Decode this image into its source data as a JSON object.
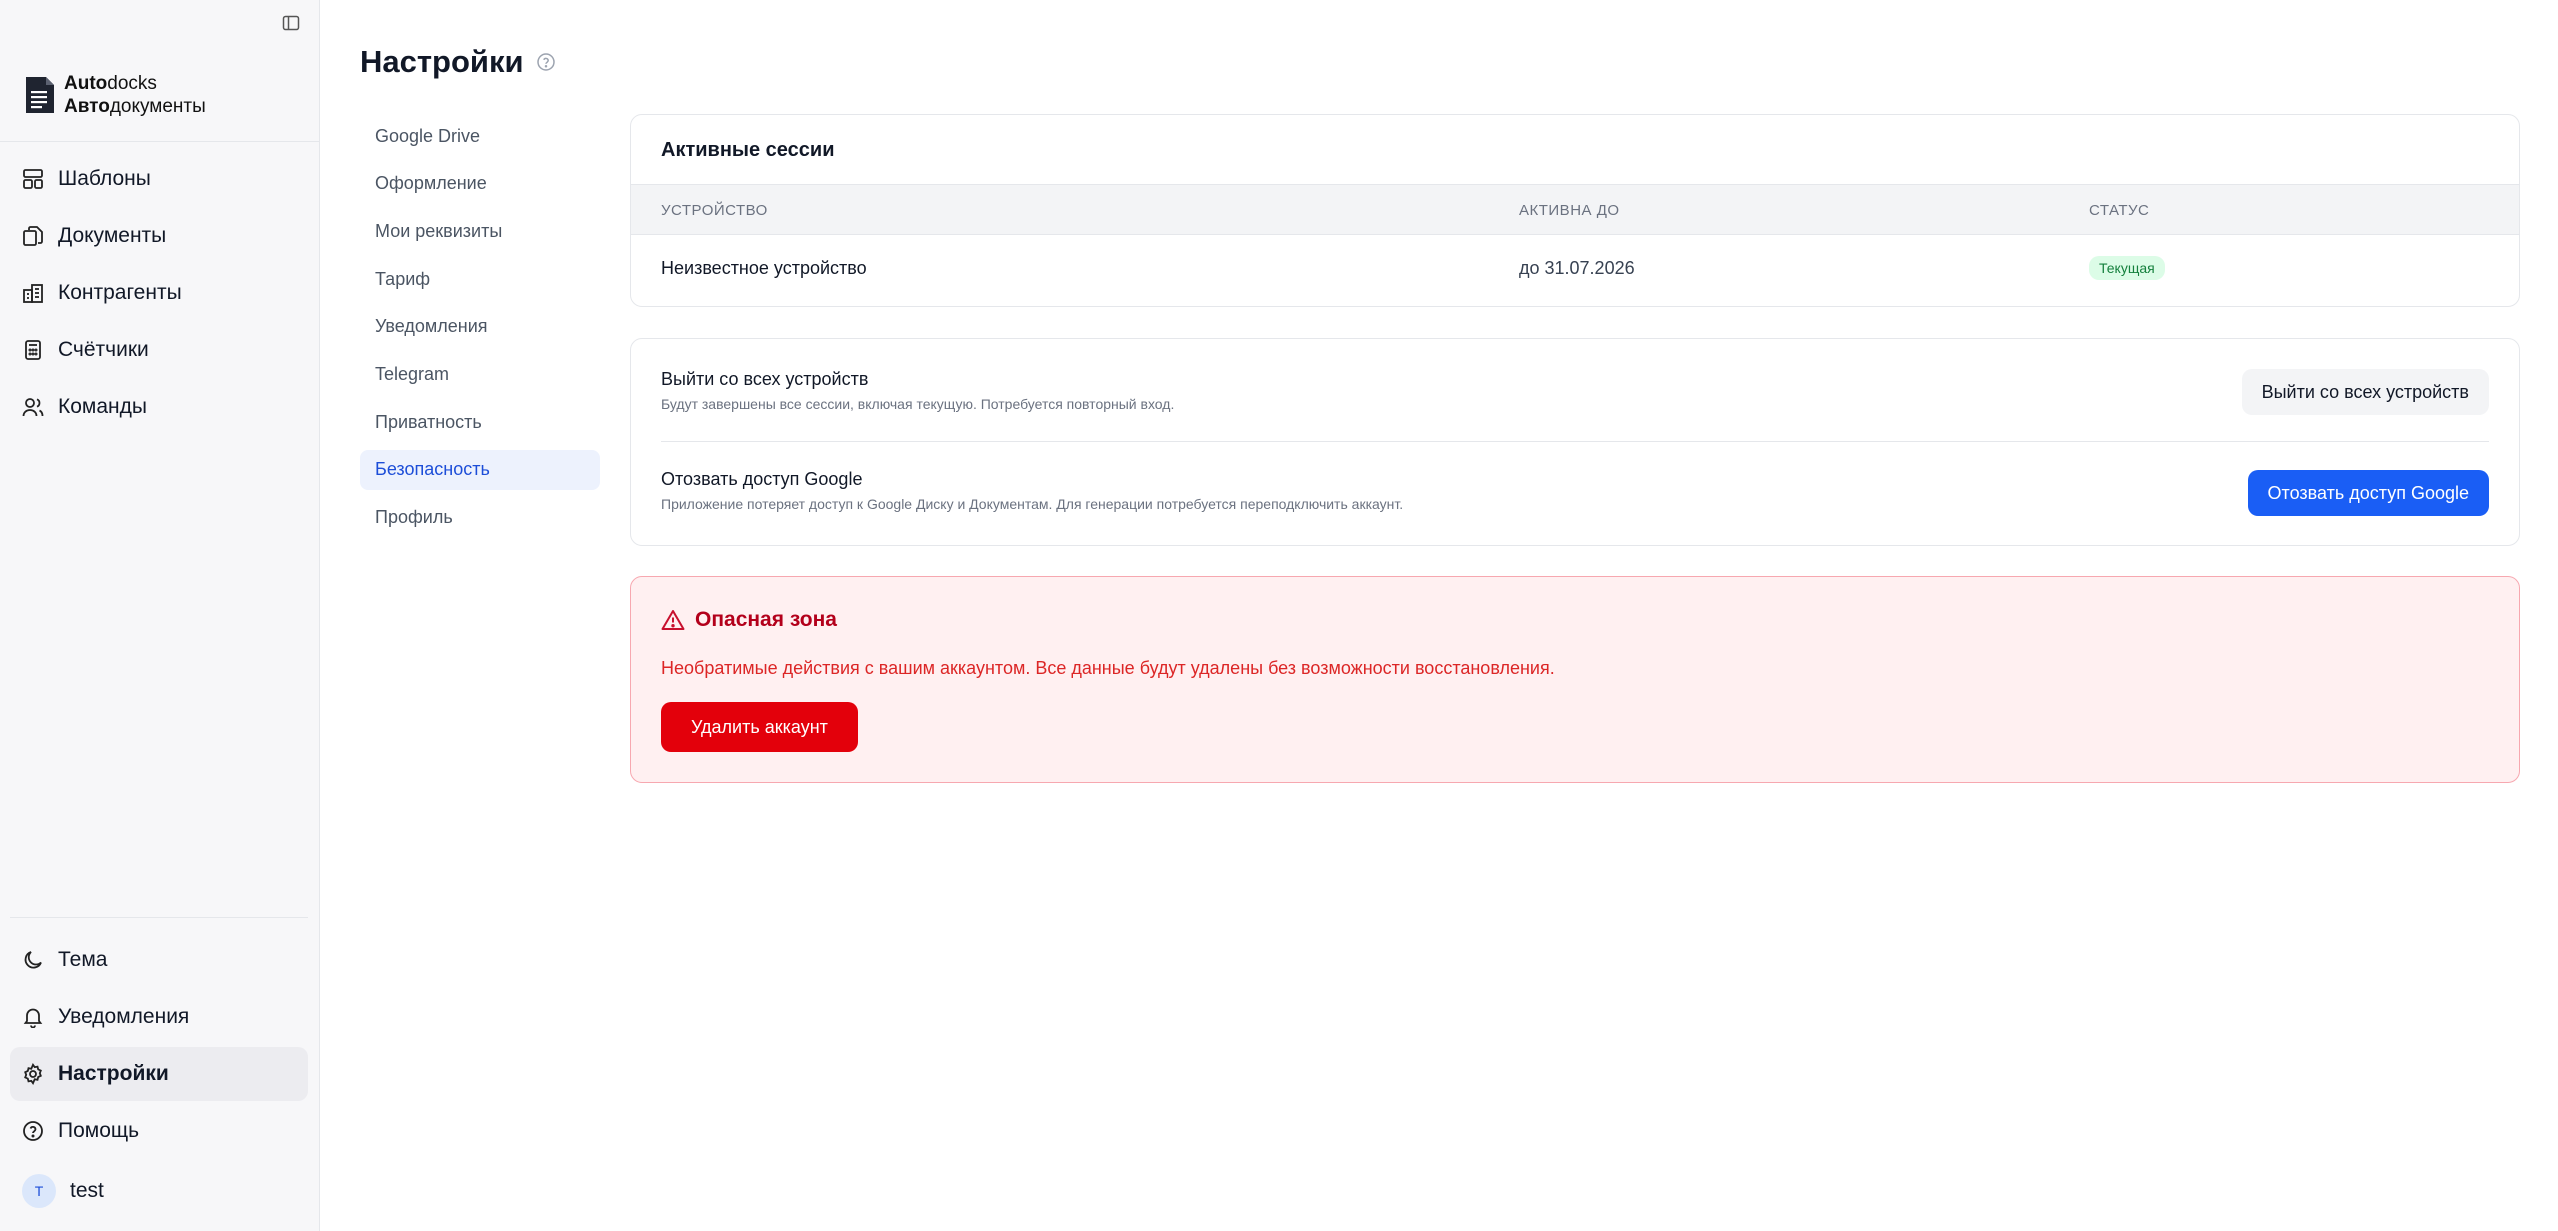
{
  "brand": {
    "line1_bold": "Auto",
    "line1_rest": "docks",
    "line2_bold": "Авто",
    "line2_rest": "документы"
  },
  "sidebar": {
    "items": [
      {
        "label": "Шаблоны",
        "icon": "layout-template-icon"
      },
      {
        "label": "Документы",
        "icon": "documents-icon"
      },
      {
        "label": "Контрагенты",
        "icon": "building-icon"
      },
      {
        "label": "Счётчики",
        "icon": "calculator-icon"
      },
      {
        "label": "Команды",
        "icon": "users-icon"
      }
    ],
    "bottom": [
      {
        "label": "Тема",
        "icon": "moon-icon"
      },
      {
        "label": "Уведомления",
        "icon": "bell-icon"
      },
      {
        "label": "Настройки",
        "icon": "gear-icon",
        "active": true
      },
      {
        "label": "Помощь",
        "icon": "help-circle-icon"
      }
    ],
    "user": {
      "initial": "T",
      "name": "test"
    }
  },
  "page": {
    "title": "Настройки"
  },
  "settings_nav": [
    {
      "label": "Google Drive"
    },
    {
      "label": "Оформление"
    },
    {
      "label": "Мои реквизиты"
    },
    {
      "label": "Тариф"
    },
    {
      "label": "Уведомления"
    },
    {
      "label": "Telegram"
    },
    {
      "label": "Приватность"
    },
    {
      "label": "Безопасность",
      "active": true
    },
    {
      "label": "Профиль"
    }
  ],
  "sessions": {
    "title": "Активные сессии",
    "columns": [
      "УСТРОЙСТВО",
      "АКТИВНА ДО",
      "СТАТУС"
    ],
    "rows": [
      {
        "device": "Неизвестное устройство",
        "until": "до 31.07.2026",
        "status": "Текущая"
      }
    ]
  },
  "actions": {
    "logout_all": {
      "title": "Выйти со всех устройств",
      "description": "Будут завершены все сессии, включая текущую. Потребуется повторный вход.",
      "button": "Выйти со всех устройств"
    },
    "revoke_google": {
      "title": "Отозвать доступ Google",
      "description": "Приложение потеряет доступ к Google Диску и Документам. Для генерации потребуется переподключить аккаунт.",
      "button": "Отозвать доступ Google"
    }
  },
  "danger_zone": {
    "title": "Опасная зона",
    "description": "Необратимые действия с вашим аккаунтом. Все данные будут удалены без возможности восстановления.",
    "button": "Удалить аккаунт"
  },
  "colors": {
    "accent": "#1a5ef5",
    "danger": "#e3000b",
    "danger_bg": "#fff0f1",
    "success": "#15803d"
  }
}
